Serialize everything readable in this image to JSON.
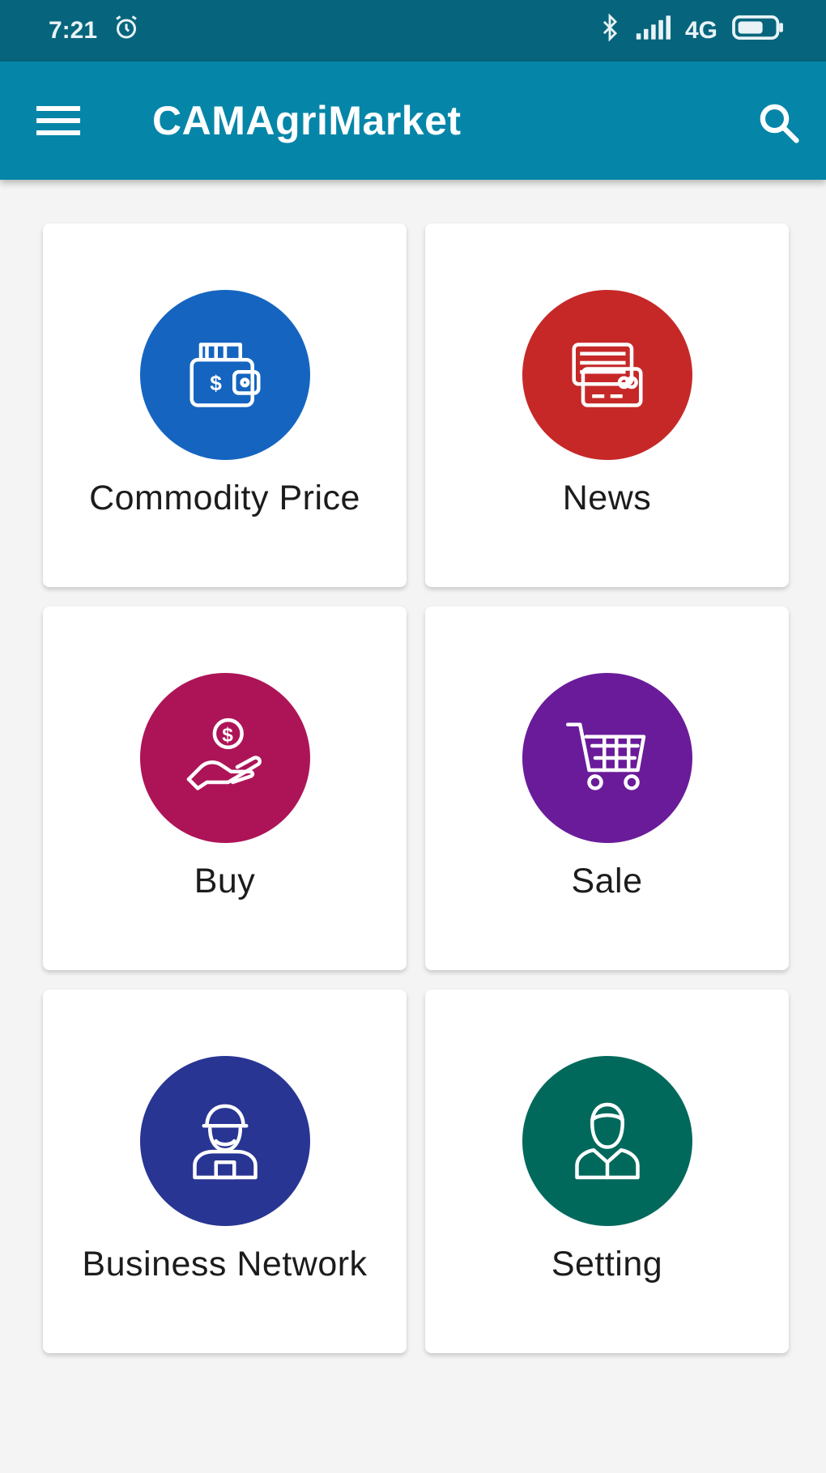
{
  "status_bar": {
    "time": "7:21",
    "network": "4G",
    "icons": [
      "alarm-icon",
      "bluetooth-icon",
      "signal-icon",
      "battery-icon"
    ]
  },
  "app_bar": {
    "title": "CAMAgriMarket",
    "background": "#0586a8",
    "menu_icon": "hamburger-menu-icon",
    "search_icon": "search-icon"
  },
  "menu": [
    {
      "id": "commodity-price",
      "label": "Commodity Price",
      "color": "#1565c0",
      "icon": "wallet-icon"
    },
    {
      "id": "news",
      "label": "News",
      "color": "#c62828",
      "icon": "newspaper-icon"
    },
    {
      "id": "buy",
      "label": "Buy",
      "color": "#ad1457",
      "icon": "hand-coin-icon"
    },
    {
      "id": "sale",
      "label": "Sale",
      "color": "#6a1b9a",
      "icon": "shopping-cart-icon"
    },
    {
      "id": "business-network",
      "label": "Business Network",
      "color": "#283593",
      "icon": "worker-icon"
    },
    {
      "id": "setting",
      "label": "Setting",
      "color": "#00695c",
      "icon": "person-icon"
    }
  ]
}
